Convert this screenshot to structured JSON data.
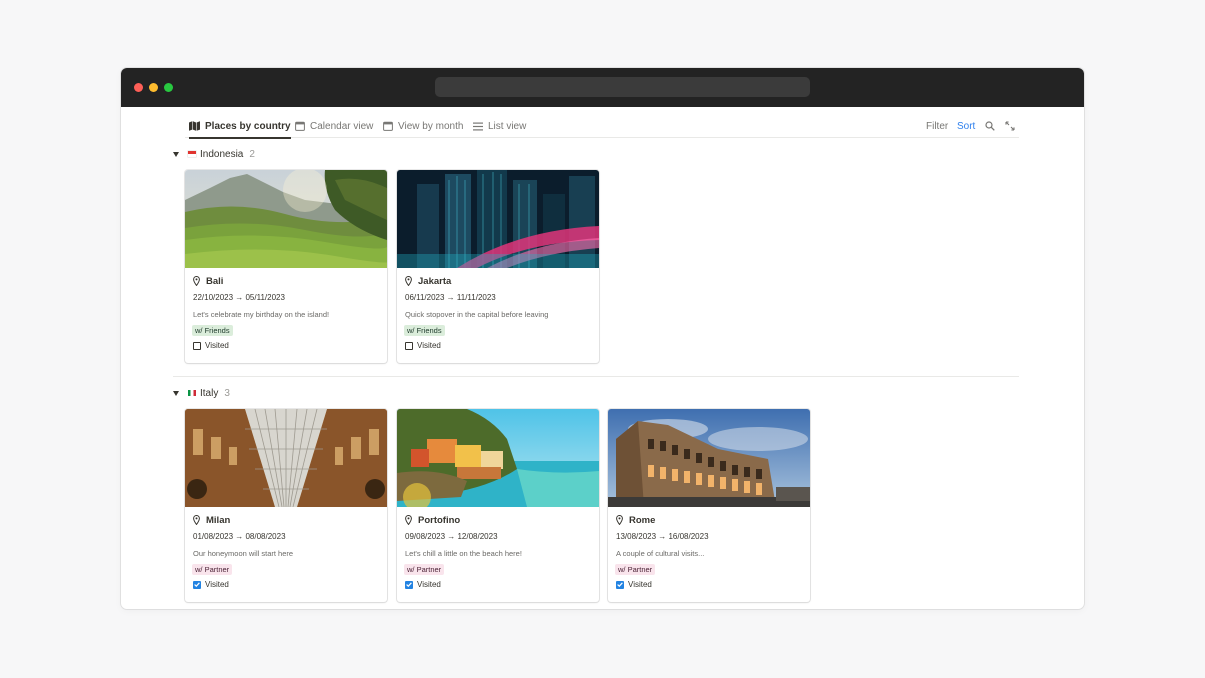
{
  "tabs": [
    {
      "label": "Places by country",
      "icon": "map-icon",
      "active": true
    },
    {
      "label": "Calendar view",
      "icon": "calendar-icon",
      "active": false
    },
    {
      "label": "View by month",
      "icon": "calendar-icon",
      "active": false
    },
    {
      "label": "List view",
      "icon": "list-icon",
      "active": false
    }
  ],
  "toolbar": {
    "filter_label": "Filter",
    "sort_label": "Sort"
  },
  "groups": [
    {
      "name": "Indonesia",
      "count": "2",
      "flag": "indonesia-flag",
      "cards": [
        {
          "title": "Bali",
          "dates": "22/10/2023 → 05/11/2023",
          "description": "Let's celebrate my birthday on the island!",
          "tag": "w/ Friends",
          "visited_label": "Visited",
          "visited": false
        },
        {
          "title": "Jakarta",
          "dates": "06/11/2023 → 11/11/2023",
          "description": "Quick stopover in the capital before leaving",
          "tag": "w/ Friends",
          "visited_label": "Visited",
          "visited": false
        }
      ]
    },
    {
      "name": "Italy",
      "count": "3",
      "flag": "italy-flag",
      "cards": [
        {
          "title": "Milan",
          "dates": "01/08/2023 → 08/08/2023",
          "description": "Our honeymoon will start here",
          "tag": "w/ Partner",
          "visited_label": "Visited",
          "visited": true
        },
        {
          "title": "Portofino",
          "dates": "09/08/2023 → 12/08/2023",
          "description": "Let's chill a little on the beach here!",
          "tag": "w/ Partner",
          "visited_label": "Visited",
          "visited": true
        },
        {
          "title": "Rome",
          "dates": "13/08/2023 → 16/08/2023",
          "description": "A couple of cultural visits...",
          "tag": "w/ Partner",
          "visited_label": "Visited",
          "visited": true
        }
      ]
    }
  ],
  "colors": {
    "accent": "#2f80ed",
    "checkbox_checked": "#2383e2",
    "tag_friends_bg": "#dbeddb",
    "tag_partner_bg": "#f9e4ec",
    "titlebar": "#232323"
  }
}
